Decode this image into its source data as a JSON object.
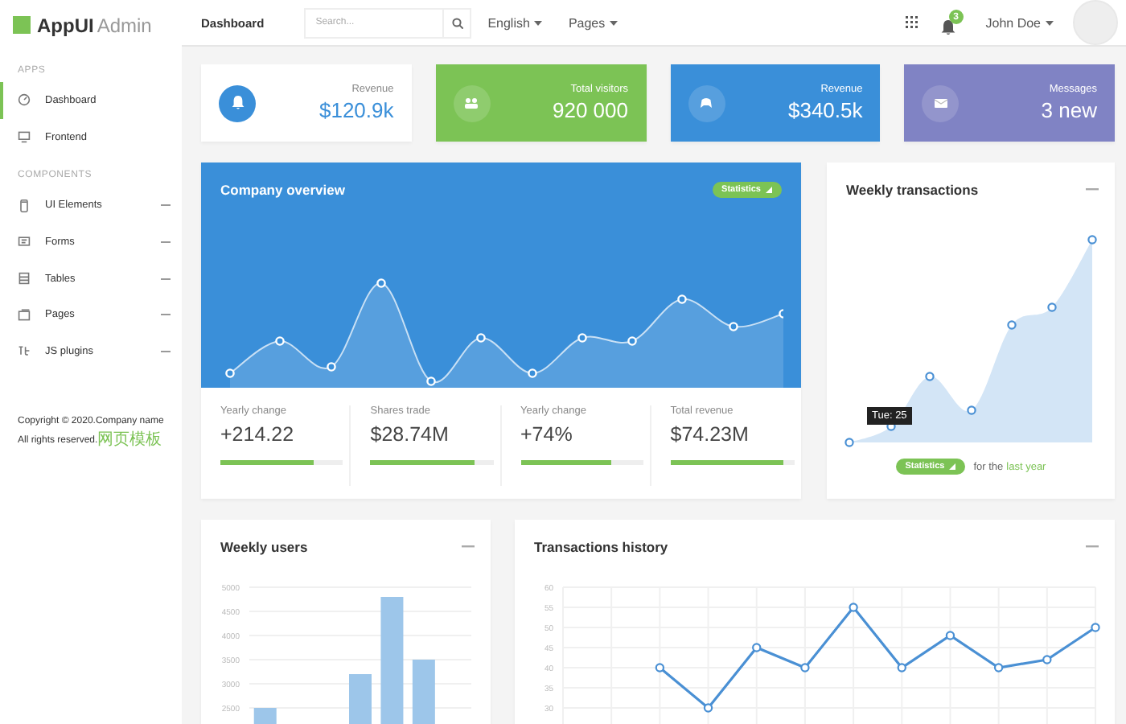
{
  "sidebar": {
    "logo": {
      "name": "AppUI",
      "suffix": "Admin"
    },
    "sections": [
      {
        "title": "APPS",
        "items": [
          {
            "label": "Dashboard",
            "selected": true,
            "has_submenu": false
          },
          {
            "label": "Frontend",
            "selected": false,
            "has_submenu": false
          }
        ]
      },
      {
        "title": "COMPONENTS",
        "items": [
          {
            "label": "UI Elements",
            "selected": false,
            "has_submenu": true
          },
          {
            "label": "Forms",
            "selected": false,
            "has_submenu": true
          },
          {
            "label": "Tables",
            "selected": false,
            "has_submenu": true
          },
          {
            "label": "Pages",
            "selected": false,
            "has_submenu": true
          },
          {
            "label": "JS plugins",
            "selected": false,
            "has_submenu": true
          }
        ]
      }
    ],
    "footer": {
      "copyright": "Copyright © 2020.Company name",
      "rights": "All rights reserved.",
      "link": "网页模板"
    }
  },
  "topbar": {
    "title": "Dashboard",
    "search": {
      "placeholder": "Search..."
    },
    "menus": [
      "English",
      "Pages"
    ],
    "notifications": "3",
    "user": "John Doe"
  },
  "stat_cards": [
    {
      "kind": "outline",
      "color": "#3a8fd9",
      "label": "Revenue",
      "value": "$120.9k"
    },
    {
      "kind": "filled",
      "color": "#7cc355",
      "label": "Total visitors",
      "value": "920 000"
    },
    {
      "kind": "filled",
      "color": "#3a8fd9",
      "label": "Revenue",
      "value": "$340.5k"
    },
    {
      "kind": "filled",
      "color": "#8083c4",
      "label": "Messages",
      "value": "3 new"
    }
  ],
  "company_overview": {
    "title": "Company overview",
    "badge": "Statistics",
    "stats": [
      {
        "label": "Yearly change",
        "value": "+214.22",
        "level": 0.76
      },
      {
        "label": "Shares trade",
        "value": "$28.74M",
        "level": 0.85
      },
      {
        "label": "Yearly change",
        "value": "+74%",
        "level": 0.74
      },
      {
        "label": "Total revenue",
        "value": "$74.23M",
        "level": 0.91
      }
    ]
  },
  "weekly_transactions": {
    "title": "Weekly transactions",
    "tooltip": "Tue: 25",
    "badge": "Statistics",
    "note": "for the",
    "link": "last year"
  },
  "weekly_users": {
    "title": "Weekly users",
    "chart_data": {
      "type": "bar",
      "grid": true,
      "ylim": [
        0,
        5000
      ],
      "yticks": [
        2500,
        3000,
        3500,
        4000,
        4500,
        5000
      ],
      "values": [
        2500,
        null,
        null,
        3200,
        4800,
        3500,
        null
      ]
    }
  },
  "transactions_history": {
    "title": "Transactions history",
    "chart_data": {
      "type": "line",
      "grid": true,
      "marker": true,
      "ylim": [
        0,
        60
      ],
      "yticks": [
        30,
        35,
        40,
        45,
        50,
        55,
        60
      ],
      "values": [
        null,
        40,
        30,
        45,
        40,
        55,
        40,
        48,
        40,
        42,
        50
      ]
    }
  }
}
